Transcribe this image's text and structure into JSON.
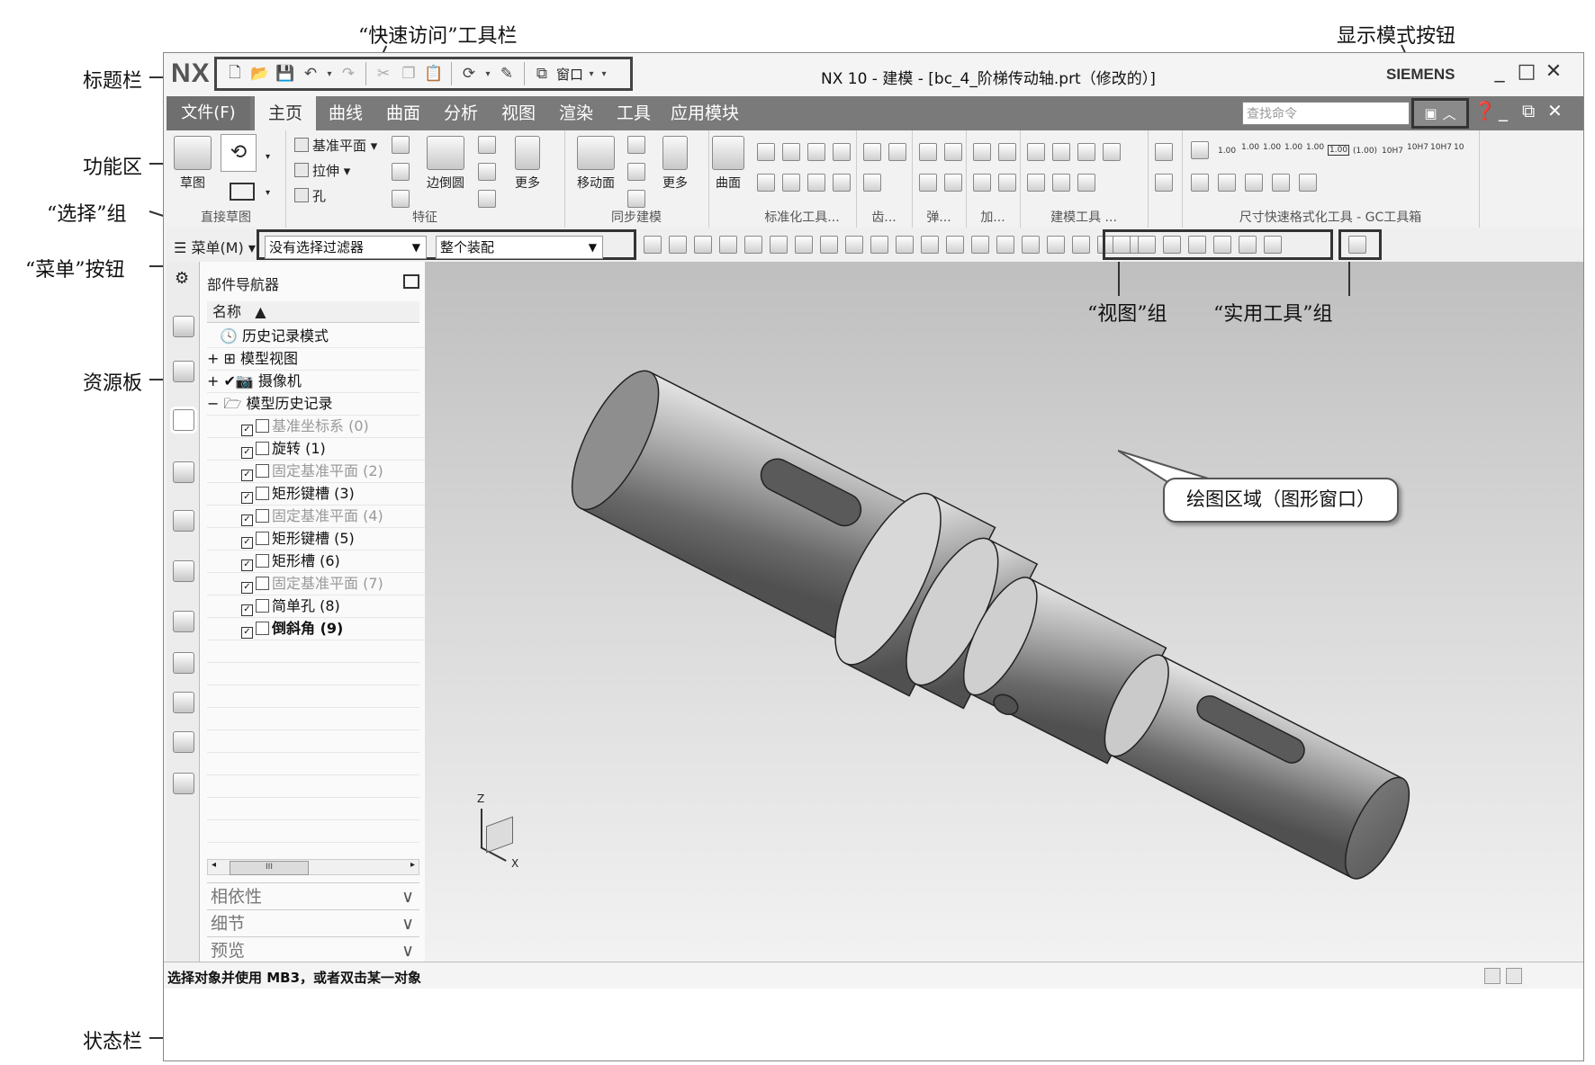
{
  "annotations": {
    "quick_access": "“快速访问”工具栏",
    "display_mode": "显示模式按钮",
    "title_bar": "标题栏",
    "ribbon": "功能区",
    "selection_group": "“选择”组",
    "menu_button": "“菜单”按钮",
    "resource_bar": "资源板",
    "status_bar": "状态栏",
    "view_group": "“视图”组",
    "utility_group": "“实用工具”组",
    "graphics_area": "绘图区域（图形窗口）"
  },
  "titlebar": {
    "logo": "NX",
    "title": "NX 10 - 建模 - [bc_4_阶梯传动轴.prt（修改的）]",
    "brand": "SIEMENS",
    "window_menu": "窗口",
    "minimize": "_",
    "maximize": "□",
    "close": "✕"
  },
  "tabs": {
    "file": "文件(F)",
    "items": [
      "主页",
      "曲线",
      "曲面",
      "分析",
      "视图",
      "渲染",
      "工具",
      "应用模块"
    ],
    "search_placeholder": "查找命令"
  },
  "ribbon": {
    "sketch": "草图",
    "datum_plane": "基准平面",
    "extrude": "拉伸",
    "hole": "孔",
    "edge_blend": "边倒圆",
    "more1": "更多",
    "move_face": "移动面",
    "more2": "更多",
    "surface": "曲面",
    "groups": {
      "direct_sketch": "直接草图",
      "feature": "特征",
      "sync": "同步建模",
      "standard": "标准化工具...",
      "gear": "齿...",
      "spring": "弹...",
      "add": "加...",
      "modeling_tools": "建模工具 ...",
      "dim": "尺寸快速格式化工具 - GC工具箱"
    },
    "dim_labels": [
      "1.00",
      "1.00",
      "1.00",
      "1.00",
      "1.00",
      "1.00",
      "(1.00)",
      "10H7",
      "10H7",
      "10H7",
      "10"
    ]
  },
  "selbar": {
    "menu": "菜单(M)",
    "filter": "没有选择过滤器",
    "scope": "整个装配"
  },
  "navigator": {
    "title": "部件导航器",
    "column": "名称",
    "nodes": [
      {
        "text": "历史记录模式",
        "style": "normal"
      },
      {
        "text": "模型视图",
        "style": "normal"
      },
      {
        "text": "摄像机",
        "style": "normal"
      },
      {
        "text": "模型历史记录",
        "style": "normal"
      },
      {
        "text": "基准坐标系 (0)",
        "style": "dim"
      },
      {
        "text": "旋转 (1)",
        "style": "normal"
      },
      {
        "text": "固定基准平面 (2)",
        "style": "dim"
      },
      {
        "text": "矩形键槽 (3)",
        "style": "normal"
      },
      {
        "text": "固定基准平面 (4)",
        "style": "dim"
      },
      {
        "text": "矩形键槽 (5)",
        "style": "normal"
      },
      {
        "text": "矩形槽 (6)",
        "style": "normal"
      },
      {
        "text": "固定基准平面 (7)",
        "style": "dim"
      },
      {
        "text": "简单孔 (8)",
        "style": "normal"
      },
      {
        "text": "倒斜角 (9)",
        "style": "bold"
      }
    ],
    "scroll_thumb": "III",
    "panels": [
      "相依性",
      "细节",
      "预览"
    ]
  },
  "status": {
    "text": "选择对象并使用 MB3，或者双击某一对象"
  },
  "triad": {
    "z": "Z",
    "x": "X"
  }
}
